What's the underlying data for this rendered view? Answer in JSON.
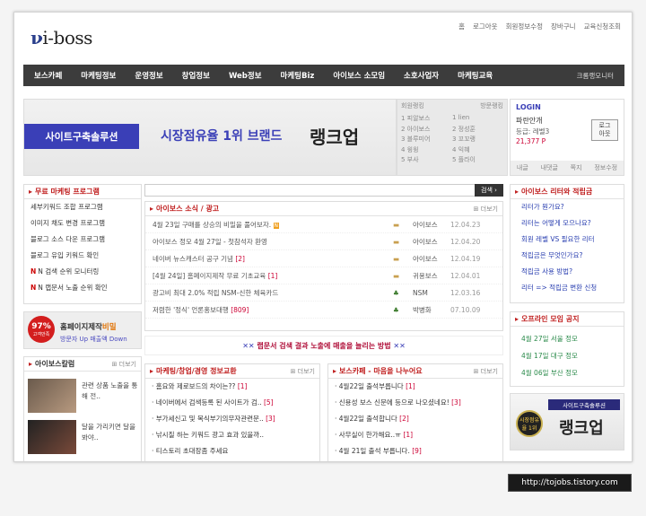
{
  "logo": {
    "text": "i-boss"
  },
  "toplinks": [
    "홈",
    "로그아웃",
    "회원정보수정",
    "장바구니",
    "교육신청조회"
  ],
  "nav": [
    "보스카페",
    "마케팅정보",
    "운영정보",
    "창업정보",
    "Web정보",
    "마케팅Biz",
    "아이보스 소모임",
    "소호사업자",
    "마케팅교육",
    "크롬랭모니터"
  ],
  "banner": {
    "label": "사이트구축솔루션",
    "t1": "시장점유율 1위 브랜드",
    "t2": "랭크업"
  },
  "ranking": {
    "tab1": "회원랭킹",
    "tab2": "방문랭킹",
    "rows": [
      [
        "1 피알보스",
        "1 lien"
      ],
      [
        "2 아이보스",
        "2 정성훈"
      ],
      [
        "3 블루미어",
        "3 꼬꼬랭"
      ],
      [
        "4 윙윙",
        "4 익혜"
      ],
      [
        "5 부사",
        "5 플라이"
      ]
    ]
  },
  "login": {
    "header": "LOGIN",
    "user": "파란안개",
    "level": "등급: 레벨3",
    "points": "21,377 P",
    "button": "로그\n아웃",
    "tabs": [
      "내글",
      "내댓글",
      "쪽지",
      "정보수정"
    ]
  },
  "free_marketing": {
    "title": "무료 마케팅 프로그램",
    "items": [
      "세부키워드 조합 프로그램",
      "이미지 채도 변경 프로그램",
      "블로그 소스 다운 프로그램",
      "블로그 유입 키워드 확인",
      "N 검색 순위 모니터링",
      "N 랩문서 노출 순위 확인"
    ]
  },
  "ad": {
    "percent": "97%",
    "percent_sub": "고객만족",
    "text1": "홈페이지제작",
    "text1b": "비밀",
    "text2": "방문자 Up 매출액 Down"
  },
  "column": {
    "title": "아이보스칼럼",
    "more": "더보기",
    "items": [
      "관련 상품 노출을 통해 전..",
      "달을 가리키면 달을 봐야.."
    ]
  },
  "search": {
    "button": "검색"
  },
  "news": {
    "title": "아이보스 소식 / 광고",
    "more": "더보기",
    "rows": [
      {
        "title": "4월 23일 구매를 상승의 비밀을 풀어보자.",
        "author": "아이보스",
        "date": "12.04.23",
        "new": "N"
      },
      {
        "title": "아이보스 정모 4월 27일 - 첫참석자 환영",
        "author": "아이보스",
        "date": "12.04.20",
        "new": ""
      },
      {
        "title": "네이버 뉴스캐스터 공구 기념",
        "author": "아이보스",
        "date": "12.04.19",
        "count": "[2]"
      },
      {
        "title": "[4월 24일] 홈페이지제작 무료 기초교육",
        "author": "귀용보스",
        "date": "12.04.01",
        "count": "[1]"
      },
      {
        "title": "광고비 최대 2.0% 적립 NSM-신한 체육카드",
        "author": "NSM",
        "date": "12.03.16",
        "count": ""
      },
      {
        "title": "저렴한 '정식' 언론홍보대행",
        "author": "박병화",
        "date": "07.10.09",
        "count": "[809]"
      }
    ]
  },
  "promo": {
    "text": "랩문서 검색 결과 노출에 매출을 늘리는 방법"
  },
  "market_info": {
    "title": "마케팅/창업/경영 정보교환",
    "more": "더보기",
    "items": [
      [
        "홈요와 제로보드의 차이는??",
        "[1]"
      ],
      [
        "네이버에서 검색등록 된 사이트가 검..",
        "[5]"
      ],
      [
        "부가세신고 및 복식부기의무자관련문..",
        "[3]"
      ],
      [
        "낚시질 하는 키워드 광고 효과 있을까..",
        ""
      ],
      [
        "티스토리 초대장좀 주세요",
        ""
      ]
    ]
  },
  "cafe": {
    "title": "보스카페 - 마음을 나누어요",
    "more": "더보기",
    "items": [
      [
        "4월22일 출석부릅니다",
        "[1]"
      ],
      [
        "신용성 보스 신문에 등으로 나오셨네요!",
        "[3]"
      ],
      [
        "4월22일 출석합니다",
        "[2]"
      ],
      [
        "사무실이 한가해요..ㅠ",
        "[1]"
      ],
      [
        "4월 21일 출석 부릅니다.",
        "[9]"
      ]
    ]
  },
  "reward": {
    "title": "아이보스 리터와 적립금",
    "items": [
      "리터가 뭔가요?",
      "리터는 어떻게 모으나요?",
      "회원 레벨 VS 필요한 리터",
      "적립금은 무엇인가요?",
      "적립금 사용 방법?",
      "리터 => 적립금 변환 신청"
    ]
  },
  "offline": {
    "title": "오프라인 모임 공지",
    "items": [
      "4월 27일 서울 정모",
      "4월 17일 대구 정모",
      "4월 06일 부산 정모"
    ]
  },
  "side_ad": {
    "label": "사이트구축솔루션",
    "medal": "시장점유율 1위",
    "brand": "랭크업"
  },
  "stamp": "http://tojobs.tistory.com",
  "colors": {
    "accent": "#3a3fb7",
    "red": "#c02020",
    "nav": "#3c3c3c"
  }
}
